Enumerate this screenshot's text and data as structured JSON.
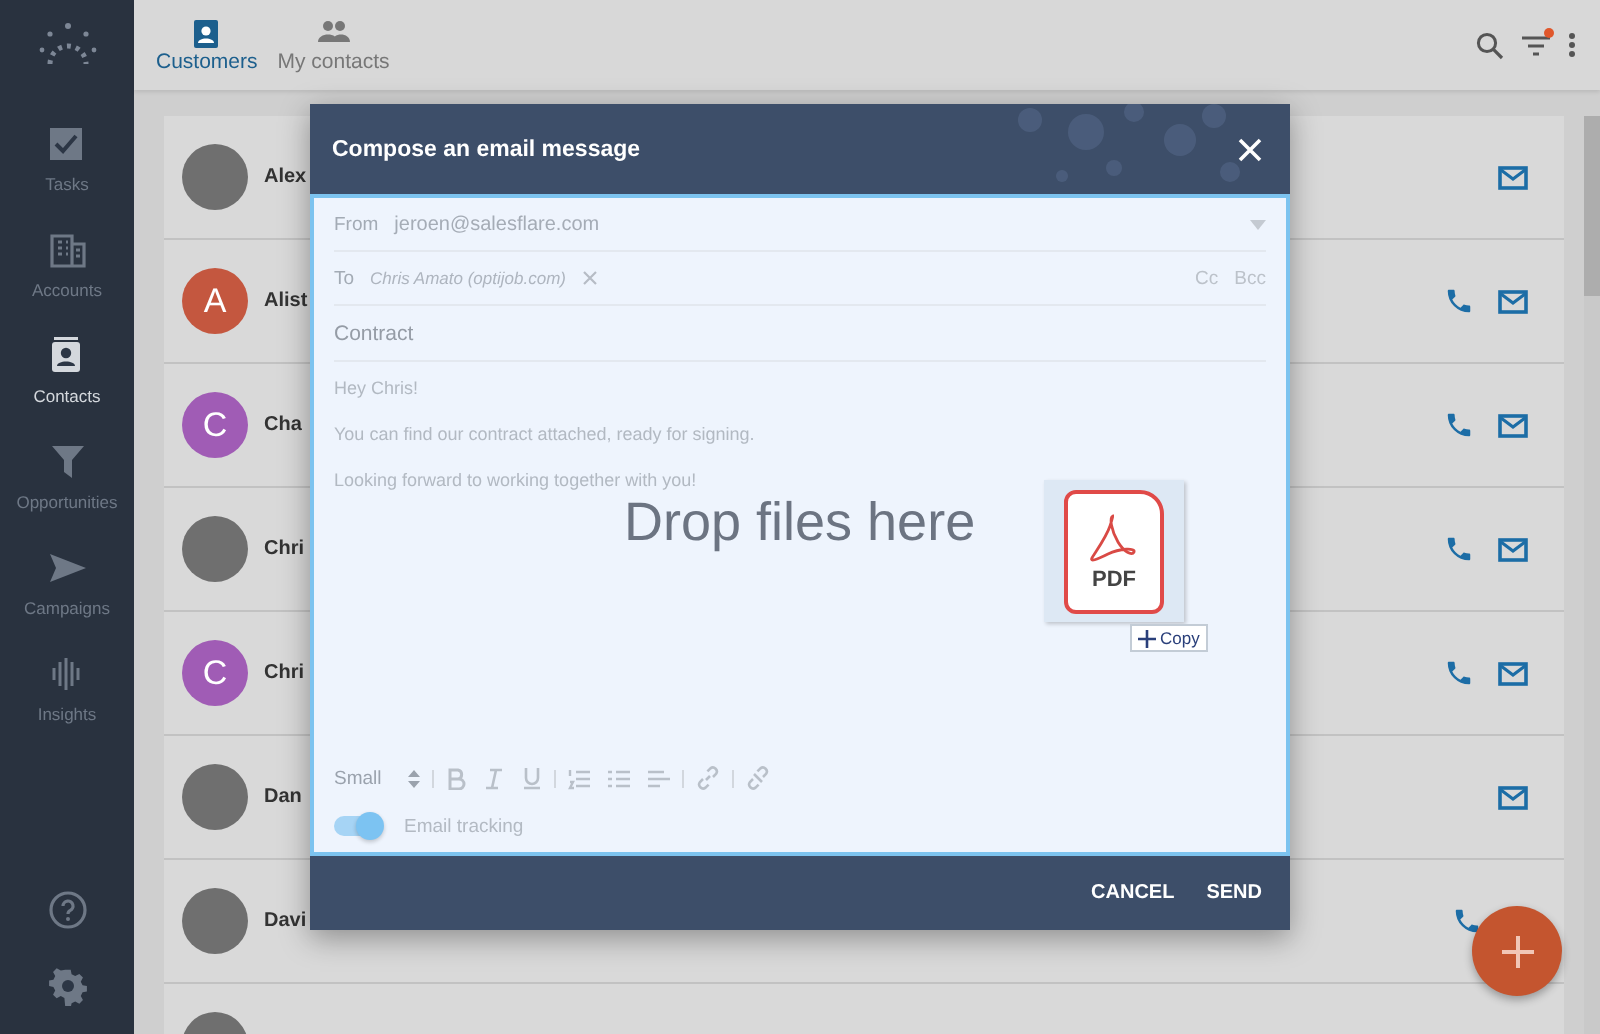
{
  "sidebar": {
    "items": [
      {
        "label": "Tasks",
        "selected": false
      },
      {
        "label": "Accounts",
        "selected": false
      },
      {
        "label": "Contacts",
        "selected": true
      },
      {
        "label": "Opportunities",
        "selected": false
      },
      {
        "label": "Campaigns",
        "selected": false
      },
      {
        "label": "Insights",
        "selected": false
      }
    ]
  },
  "tabs": [
    {
      "label": "Customers",
      "selected": true
    },
    {
      "label": "My contacts",
      "selected": false
    }
  ],
  "toolbar": {
    "filter_active": true
  },
  "contacts": [
    {
      "name": "Alex",
      "avatar": {
        "kind": "photo"
      },
      "phone": false,
      "email": true
    },
    {
      "name": "Alist",
      "avatar": {
        "kind": "letter",
        "letter": "A",
        "color": "#c4573f"
      },
      "phone": true,
      "email": true
    },
    {
      "name": "Cha",
      "avatar": {
        "kind": "letter",
        "letter": "C",
        "color": "#a05cb5"
      },
      "phone": true,
      "email": true
    },
    {
      "name": "Chri",
      "avatar": {
        "kind": "photo"
      },
      "phone": true,
      "email": true
    },
    {
      "name": "Chri",
      "avatar": {
        "kind": "letter",
        "letter": "C",
        "color": "#a05cb5"
      },
      "phone": true,
      "email": true
    },
    {
      "name": "Dan",
      "avatar": {
        "kind": "photo"
      },
      "phone": false,
      "email": true
    },
    {
      "name": "Davi",
      "avatar": {
        "kind": "photo"
      },
      "phone": true,
      "email": false
    },
    {
      "avatar": {
        "kind": "photo"
      },
      "phone": false,
      "email": false
    }
  ],
  "dialog": {
    "title": "Compose an email message",
    "from_label": "From",
    "from": "jeroen@salesflare.com",
    "to_label": "To",
    "recipients": [
      {
        "label": "Chris Amato (optijob.com)"
      }
    ],
    "cc": "Cc",
    "bcc": "Bcc",
    "subject": "Contract",
    "body": [
      "Hey Chris!",
      "You can find our contract attached, ready for signing.",
      "Looking forward to working together with you!"
    ],
    "drop_hint": "Drop files here",
    "dragged_file": {
      "label": "PDF",
      "action": "Copy"
    },
    "format_size": "Small",
    "tracking": {
      "label": "Email tracking",
      "on": true
    },
    "buttons": [
      "CANCEL",
      "SEND"
    ]
  }
}
